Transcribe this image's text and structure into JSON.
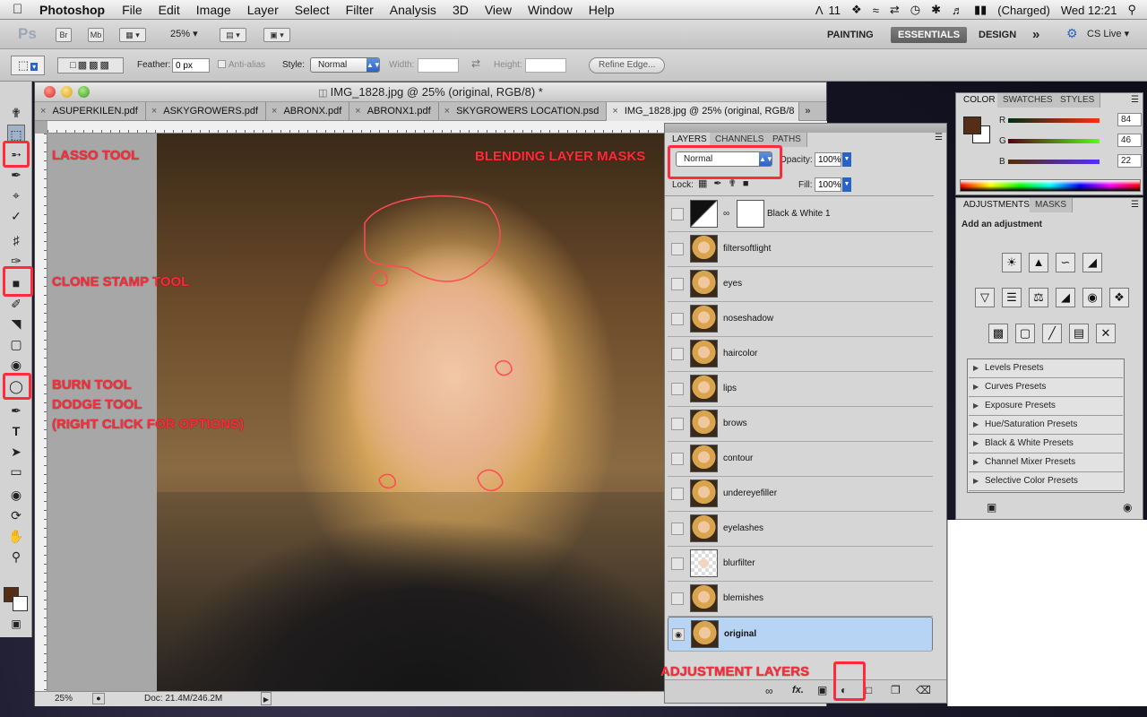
{
  "menubar": {
    "app": "Photoshop",
    "items": [
      "File",
      "Edit",
      "Image",
      "Layer",
      "Select",
      "Filter",
      "Analysis",
      "3D",
      "View",
      "Window",
      "Help"
    ],
    "status": {
      "adobe_count": "11",
      "battery": "(Charged)",
      "clock": "Wed 12:21"
    }
  },
  "appbar": {
    "logo": "Ps",
    "bridge": "Br",
    "mini_bridge": "Mb",
    "zoom": "25%",
    "workspaces": [
      "PAINTING",
      "ESSENTIALS",
      "DESIGN"
    ],
    "more": "»",
    "cslive": "CS Live"
  },
  "options": {
    "feather_label": "Feather:",
    "feather_value": "0 px",
    "antialias": "Anti-alias",
    "style_label": "Style:",
    "style_value": "Normal",
    "width_label": "Width:",
    "height_label": "Height:",
    "refine": "Refine Edge..."
  },
  "document": {
    "title": "IMG_1828.jpg @ 25% (original, RGB/8) *",
    "tabs": [
      "ASUPERKILEN.pdf",
      "ASKYGROWERS.pdf",
      "ABRONX.pdf",
      "ABRONX1.pdf",
      "SKYGROWERS LOCATION.psd",
      "IMG_1828.jpg @ 25% (original, RGB/8"
    ],
    "tab_overflow": "»",
    "status_zoom": "25%",
    "status_doc": "Doc: 21.4M/246.2M"
  },
  "layers_panel": {
    "tabs": [
      "LAYERS",
      "CHANNELS",
      "PATHS"
    ],
    "blend_mode": "Normal",
    "opacity_label": "Opacity:",
    "opacity": "100%",
    "lock_label": "Lock:",
    "fill_label": "Fill:",
    "fill": "100%",
    "layers": [
      {
        "name": "Black & White 1"
      },
      {
        "name": "filtersoftlight"
      },
      {
        "name": "eyes"
      },
      {
        "name": "noseshadow"
      },
      {
        "name": "haircolor"
      },
      {
        "name": "lips"
      },
      {
        "name": "brows"
      },
      {
        "name": "contour"
      },
      {
        "name": "undereyefiller"
      },
      {
        "name": "eyelashes"
      },
      {
        "name": "blurfilter"
      },
      {
        "name": "blemishes"
      },
      {
        "name": "original"
      }
    ],
    "fx": "fx."
  },
  "color_panel": {
    "tabs": [
      "COLOR",
      "SWATCHES",
      "STYLES"
    ],
    "r_label": "R",
    "r": "84",
    "g_label": "G",
    "g": "46",
    "b_label": "B",
    "b": "22",
    "fg_color": "#542e16"
  },
  "adjustments_panel": {
    "tabs": [
      "ADJUSTMENTS",
      "MASKS"
    ],
    "heading": "Add an adjustment",
    "presets": [
      "Levels Presets",
      "Curves Presets",
      "Exposure Presets",
      "Hue/Saturation Presets",
      "Black & White Presets",
      "Channel Mixer Presets",
      "Selective Color Presets"
    ]
  },
  "annotations": {
    "lasso": "LASSO TOOL",
    "clone": "CLONE STAMP TOOL",
    "burn1": "BURN TOOL",
    "burn2": "DODGE TOOL",
    "burn3": "(RIGHT CLICK FOR OPTIONS)",
    "blend": "BLENDING LAYER MASKS",
    "adjust": "ADJUSTMENT LAYERS"
  },
  "colors": {
    "annotation": "#ff2b3a",
    "selected_layer": "#b7d4f4",
    "accent": "#2a63c2"
  }
}
